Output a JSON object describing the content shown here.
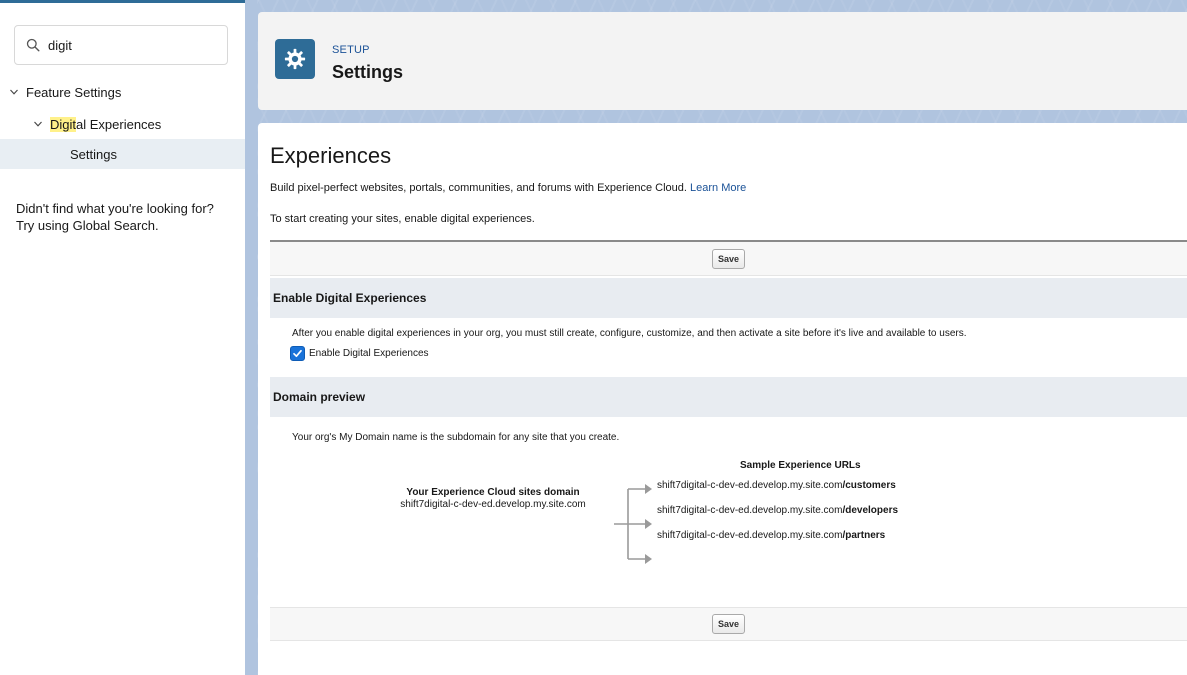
{
  "sidebar": {
    "search": {
      "value": "digit"
    },
    "tree": {
      "feature_settings": "Feature Settings",
      "digital_highlight": "Digit",
      "digital_rest": "al Experiences",
      "settings": "Settings"
    },
    "help_line1": "Didn't find what you're looking for?",
    "help_line2": "Try using Global Search."
  },
  "header": {
    "eyebrow": "SETUP",
    "title": "Settings",
    "icon": "gear-icon",
    "icon_bg": "#2e6c97"
  },
  "main": {
    "title": "Experiences",
    "description": "Build pixel-perfect websites, portals, communities, and forums with Experience Cloud.",
    "learn_more": "Learn More",
    "start_text": "To start creating your sites, enable digital experiences.",
    "save_label": "Save",
    "enable_section": {
      "heading": "Enable Digital Experiences",
      "description": "After you enable digital experiences in your org, you must still create, configure, customize, and then activate a site before it's live and available to users.",
      "checkbox_label": "Enable Digital Experiences",
      "checked": true
    },
    "domain_section": {
      "heading": "Domain preview",
      "description": "Your org's My Domain name is the subdomain for any site that you create.",
      "sites_domain_label": "Your Experience Cloud sites domain",
      "sites_domain_value": "shift7digital-c-dev-ed.develop.my.site.com",
      "sample_title": "Sample Experience URLs",
      "url_base": "shift7digital-c-dev-ed.develop.my.site.com",
      "url_suffixes": [
        "/customers",
        "/developers",
        "/partners"
      ]
    }
  },
  "colors": {
    "brand": "#2e6c97",
    "link": "#1b5297",
    "background": "#b0c4df",
    "highlight": "#fff18a"
  }
}
